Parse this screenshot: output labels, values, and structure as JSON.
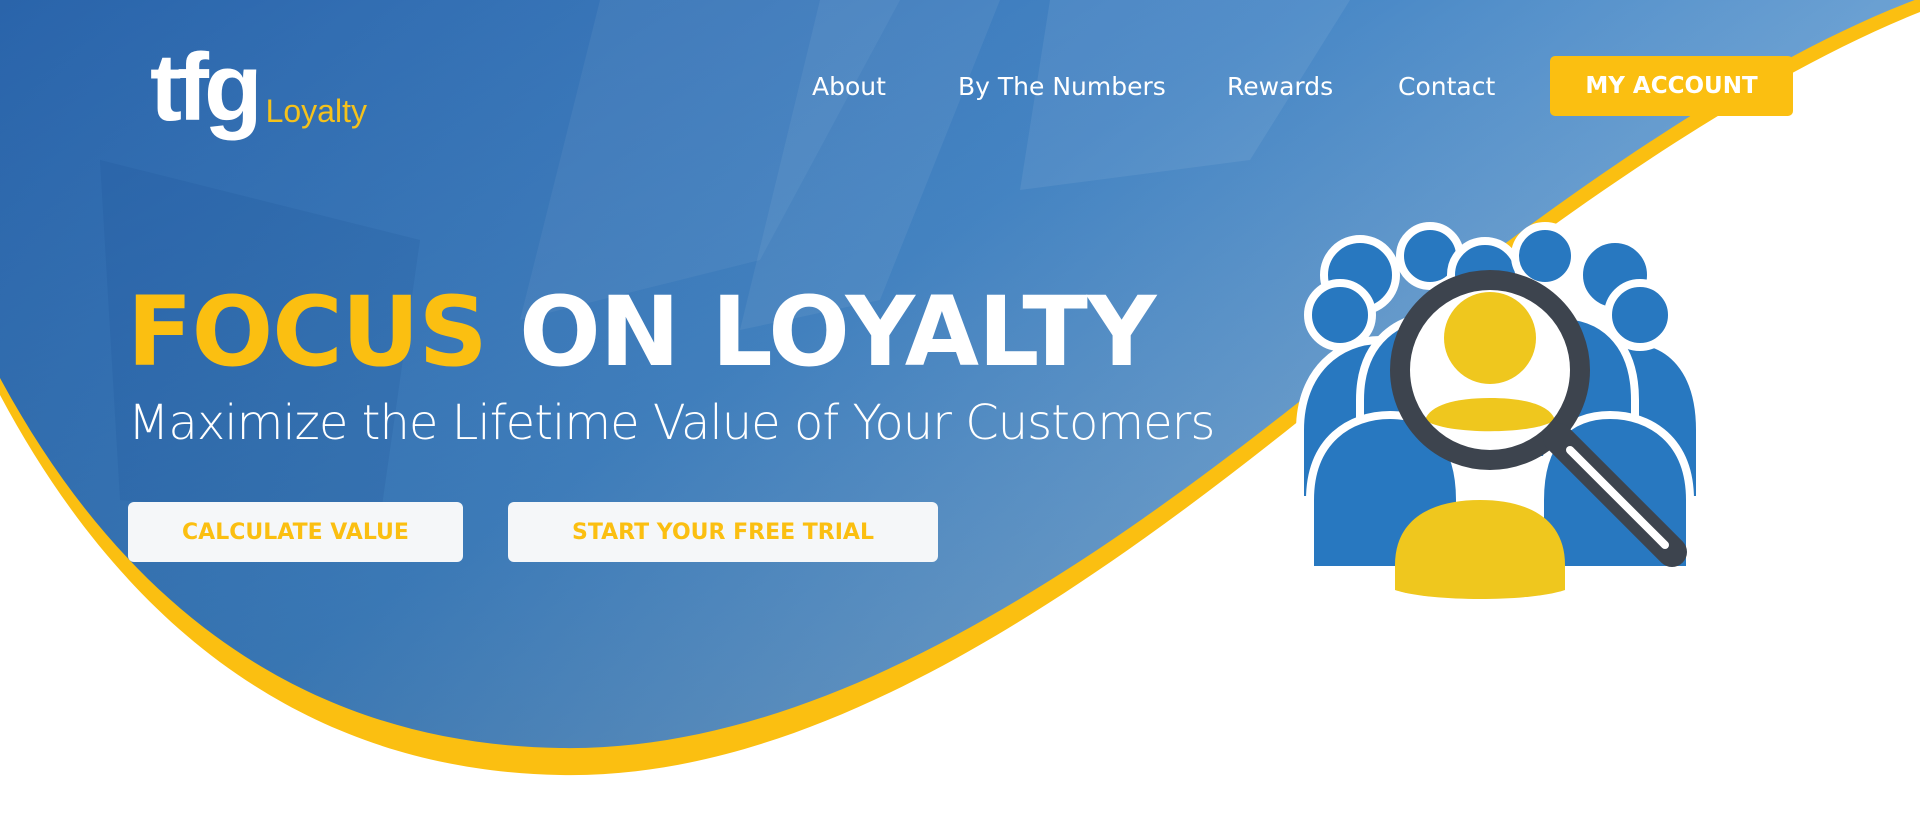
{
  "brand": {
    "logo_mark": "tfg",
    "logo_sub": "Loyalty"
  },
  "nav": {
    "items": [
      {
        "label": "About"
      },
      {
        "label": "By The Numbers"
      },
      {
        "label": "Rewards"
      },
      {
        "label": "Contact"
      }
    ],
    "account_button": "MY ACCOUNT"
  },
  "hero": {
    "headline_accent": "FOCUS",
    "headline_rest": "ON LOYALTY",
    "subheadline": "Maximize the Lifetime Value of Your Customers",
    "cta_primary": "CALCULATE VALUE",
    "cta_secondary": "START YOUR FREE TRIAL",
    "illustration_icon": "customer-search-icon"
  },
  "colors": {
    "brand_blue": "#2f6fb8",
    "accent_yellow": "#fbbf11",
    "icon_blue": "#2878c0",
    "icon_yellow": "#efc71e",
    "icon_dark": "#3d444e"
  }
}
